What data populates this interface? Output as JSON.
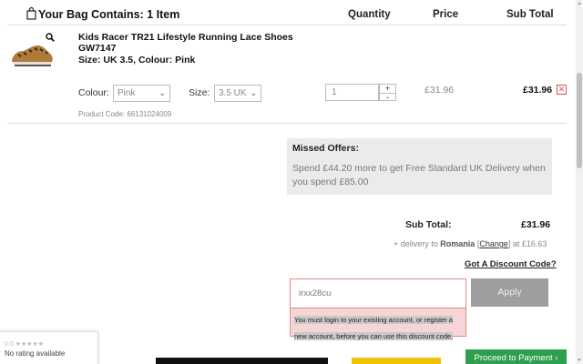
{
  "header": {
    "title": "Your Bag Contains: 1 Item",
    "col_quantity": "Quantity",
    "col_price": "Price",
    "col_subtotal": "Sub Total"
  },
  "product": {
    "name": "Kids Racer TR21 Lifestyle Running Lace Shoes GW7147",
    "size_colour": "Size: UK 3.5, Colour: Pink",
    "colour_label": "Colour:",
    "colour_value": "Pink",
    "size_label": "Size:",
    "size_value": "3.5 UK",
    "quantity": "1",
    "qty_plus": "+",
    "qty_minus": "-",
    "price": "£31.96",
    "subtotal": "£31.96",
    "remove": "✕",
    "product_code": "Product Code: 66131024009"
  },
  "missed_offers": {
    "title": "Missed Offers:",
    "text": "Spend £44.20 more to get Free Standard UK Delivery when you spend £85.00"
  },
  "totals": {
    "subtotal_label": "Sub Total:",
    "subtotal_value": "£31.96",
    "delivery_prefix": "+ delivery to",
    "delivery_country": "Romania",
    "change_link": "Change",
    "delivery_suffix": "at £16.63",
    "discount_link": "Got A Discount Code?"
  },
  "discount": {
    "code_value": "irxx28cu",
    "apply_label": "Apply",
    "error": "You must login to your existing account, or register a new account, before you can use this discount code."
  },
  "rating_widget": {
    "score": "0.0",
    "stars": "★★★★★",
    "text": "No rating available"
  },
  "footer": {
    "proceed_label": "Proceed to Payment ›"
  },
  "colors": {
    "accent_green": "#2e9e4f",
    "error_pink": "#f6d5d5",
    "error_border": "#e08b8b",
    "remove_red": "#d9534f",
    "yellow_button": "#f2c200"
  }
}
